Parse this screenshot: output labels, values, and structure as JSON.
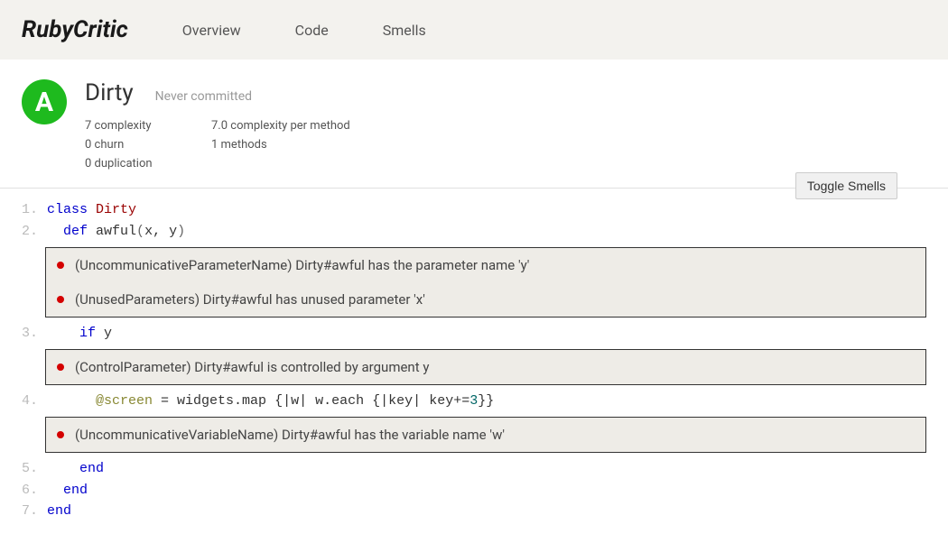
{
  "brand": "RubyCritic",
  "nav": [
    {
      "label": "Overview"
    },
    {
      "label": "Code"
    },
    {
      "label": "Smells"
    }
  ],
  "file": {
    "grade": "A",
    "name": "Dirty",
    "commit_status": "Never committed",
    "metrics_left": [
      "7 complexity",
      "0 churn",
      "0 duplication"
    ],
    "metrics_right": [
      "7.0 complexity per method",
      "1 methods"
    ]
  },
  "toggle_label": "Toggle Smells",
  "lines": {
    "l1_no": "1.",
    "l1_kw": "class ",
    "l1_cls": "Dirty",
    "l2_no": "2.",
    "l2_indent": "  ",
    "l2_kw": "def ",
    "l2_fn": "awful",
    "l2_open": "(",
    "l2_p1": "x",
    "l2_comma": ", ",
    "l2_p2": "y",
    "l2_close": ")",
    "l3_no": "3.",
    "l3_indent": "    ",
    "l3_kw": "if ",
    "l3_var": "y",
    "l4_no": "4.",
    "l4_indent": "      ",
    "l4_ivar": "@screen",
    "l4_eq": " = ",
    "l4_body1": "widgets.map ",
    "l4_brace1": "{|",
    "l4_w": "w",
    "l4_brace2": "| ",
    "l4_body2": "w.each ",
    "l4_brace3": "{|",
    "l4_key": "key",
    "l4_brace4": "| ",
    "l4_body3": "key+=",
    "l4_lit": "3",
    "l4_close": "}}",
    "l5_no": "5.",
    "l5_indent": "    ",
    "l5_kw": "end",
    "l6_no": "6.",
    "l6_indent": "  ",
    "l6_kw": "end",
    "l7_no": "7.",
    "l7_kw": "end"
  },
  "smells": {
    "g1": [
      "(UncommunicativeParameterName) Dirty#awful has the parameter name 'y'",
      "(UnusedParameters) Dirty#awful has unused parameter 'x'"
    ],
    "g2": [
      "(ControlParameter) Dirty#awful is controlled by argument y"
    ],
    "g3": [
      "(UncommunicativeVariableName) Dirty#awful has the variable name 'w'"
    ]
  }
}
